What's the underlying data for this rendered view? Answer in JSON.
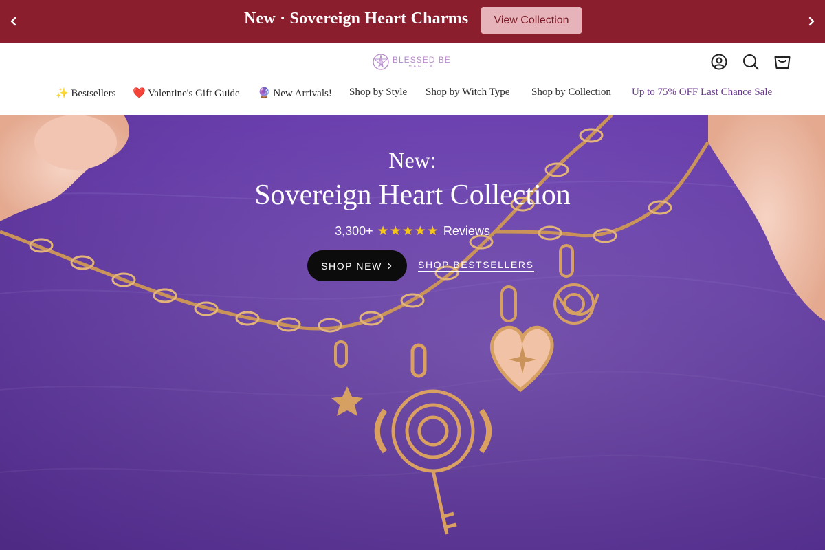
{
  "announcement": {
    "message": "New · Sovereign Heart Charms",
    "cta_label": "View Collection",
    "prev_icon": "chevron-left-icon",
    "next_icon": "chevron-right-icon"
  },
  "header": {
    "logo_text": "BLESSED BE",
    "logo_subtext": "MAGICK",
    "icons": [
      "account-icon",
      "search-icon",
      "cart-icon"
    ]
  },
  "nav": {
    "items": [
      {
        "label": "✨ Bestsellers"
      },
      {
        "label": "❤️ Valentine's Gift Guide"
      },
      {
        "label": "🔮 New Arrivals!"
      },
      {
        "label": "Shop by Style"
      },
      {
        "label": "Shop by Witch Type"
      },
      {
        "label": "Shop by Collection"
      },
      {
        "label": "Up to 75% OFF Last Chance Sale"
      }
    ]
  },
  "hero": {
    "kicker": "New:",
    "title": "Sovereign Heart Collection",
    "reviews_count": "3,300+",
    "stars": "★★★★★",
    "reviews_label": "Reviews",
    "primary_cta": "SHOP NEW",
    "secondary_cta": "SHOP BESTSELLERS"
  },
  "colors": {
    "announcement_bg": "#8b1e2d",
    "cta_bg": "#e5b3b9",
    "hero_bg": "#7b52be",
    "sale_link": "#6b3a8c",
    "gold": "#c9935a"
  }
}
